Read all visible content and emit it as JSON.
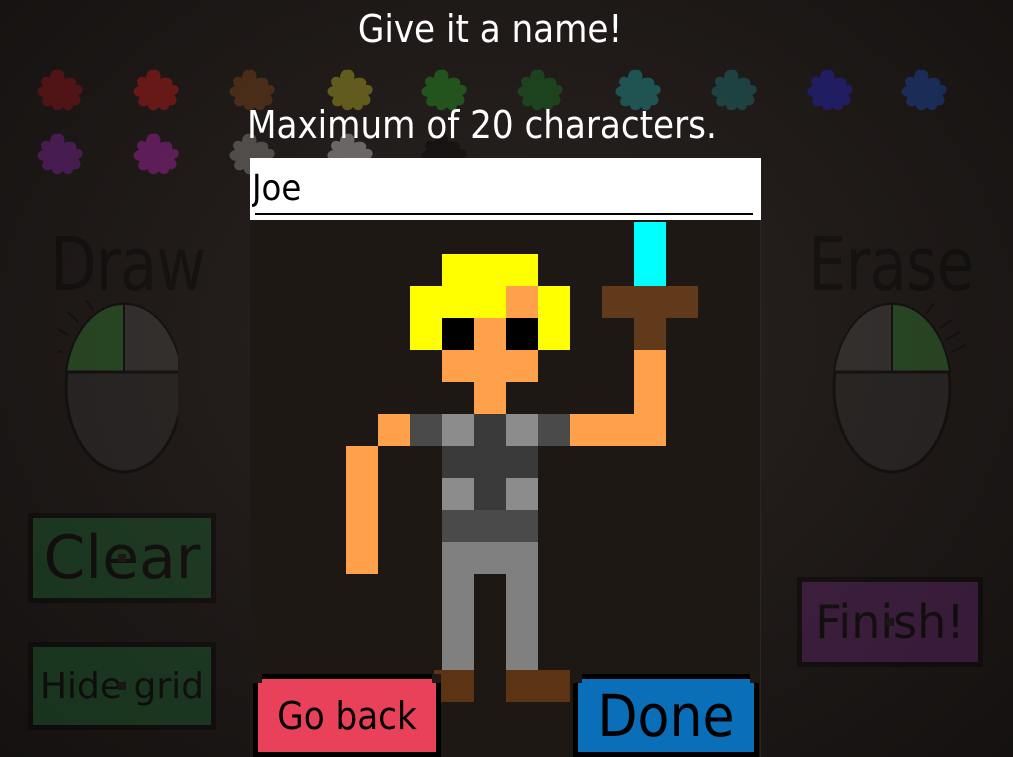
{
  "dialog": {
    "title": "Give it a name!",
    "subtitle": "Maximum of 20 characters.",
    "name_value": "Joe",
    "go_back_label": "Go back",
    "done_label": "Done"
  },
  "background_editor": {
    "draw_label": "Draw",
    "erase_label": "Erase",
    "clear_label": "Clear",
    "hide_grid_label": "Hide grid",
    "finish_label": "Finish!",
    "palette": [
      "#c0141e",
      "#ff1e1e",
      "#a0561e",
      "#e6dc28",
      "#28c828",
      "#149628",
      "#1ec8c8",
      "#1e9696",
      "#2828ff",
      "#1e5adc",
      "#a028c8",
      "#dc28dc",
      "#b4b4b4",
      "#ffffff",
      "#000000"
    ]
  },
  "colors": {
    "go_back": "#e9415a",
    "done": "#0a6fb8",
    "skin": "#ffa14a",
    "hair": "#ffff00",
    "sword_blade": "#00ffff",
    "sword_hilt": "#603a1a"
  }
}
